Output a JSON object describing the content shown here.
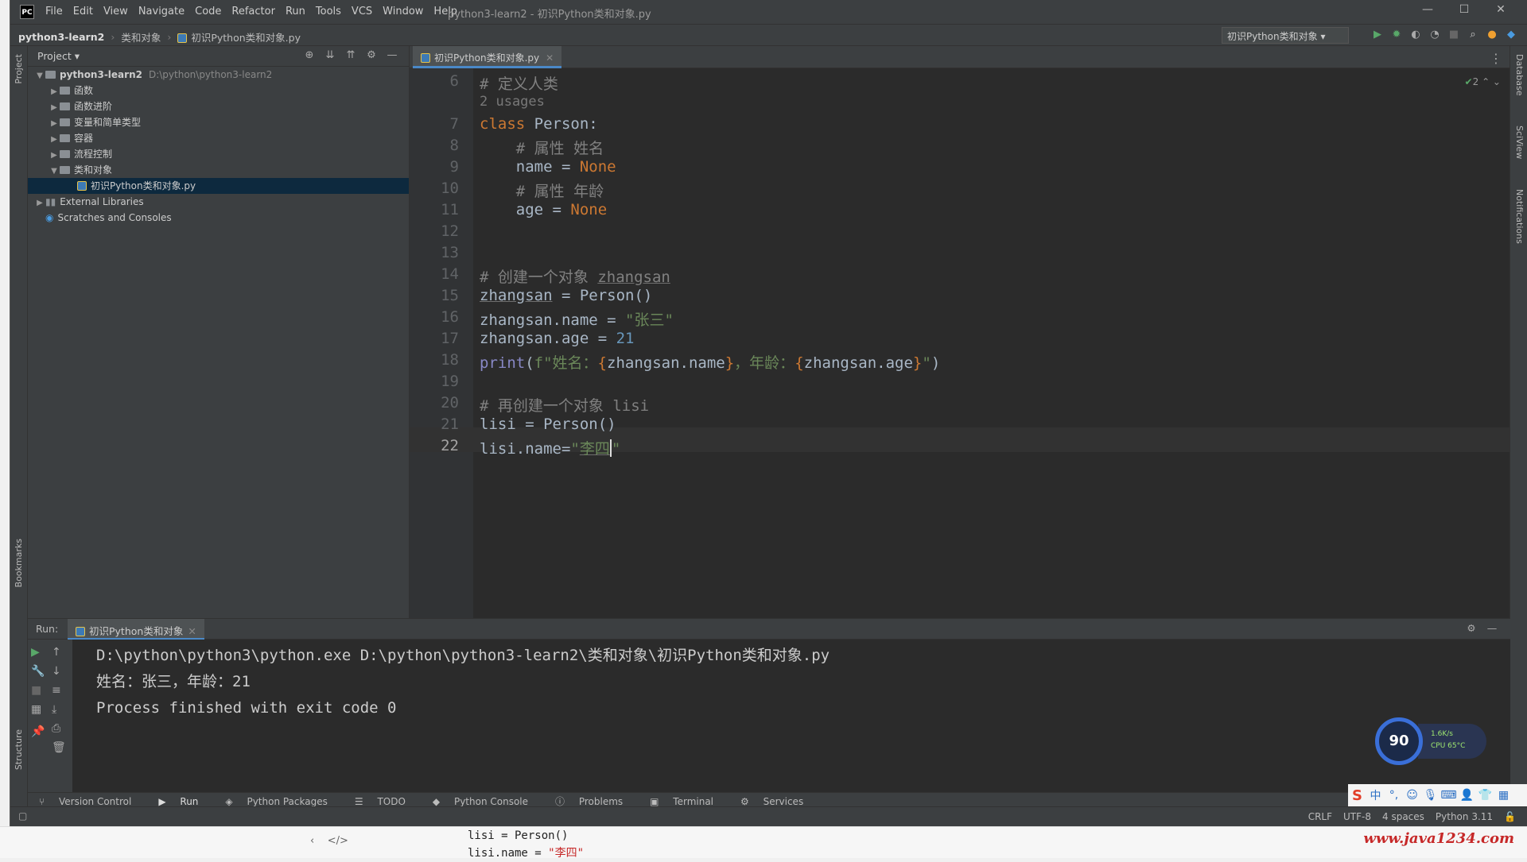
{
  "titlebar": {
    "logo": "PC",
    "menu": [
      "File",
      "Edit",
      "View",
      "Navigate",
      "Code",
      "Refactor",
      "Run",
      "Tools",
      "VCS",
      "Window",
      "Help"
    ],
    "title": "python3-learn2 - 初识Python类和对象.py",
    "controls": [
      "—",
      "☐",
      "✕"
    ]
  },
  "navbar": {
    "breadcrumb": [
      "python3-learn2",
      "类和对象",
      "初识Python类和对象.py"
    ],
    "run_config": "初识Python类和对象"
  },
  "left_strip": {
    "project": "Project",
    "bookmarks": "Bookmarks",
    "structure": "Structure"
  },
  "right_strip": {
    "database": "Database",
    "sciview": "SciView",
    "notifications": "Notifications"
  },
  "project": {
    "header": "Project",
    "tree": [
      {
        "label": "python3-learn2",
        "path": "D:\\python\\python3-learn2"
      },
      {
        "label": "函数"
      },
      {
        "label": "函数进阶"
      },
      {
        "label": "变量和简单类型"
      },
      {
        "label": "容器"
      },
      {
        "label": "流程控制"
      },
      {
        "label": "类和对象"
      },
      {
        "label": "初识Python类和对象.py"
      },
      {
        "label": "External Libraries"
      },
      {
        "label": "Scratches and Consoles"
      }
    ]
  },
  "editor": {
    "tab": "初识Python类和对象.py",
    "inspection_count": "2",
    "usages": "2 usages",
    "line_numbers": [
      "6",
      "7",
      "8",
      "9",
      "10",
      "11",
      "12",
      "13",
      "14",
      "15",
      "16",
      "17",
      "18",
      "19",
      "20",
      "21",
      "22"
    ]
  },
  "run": {
    "label": "Run:",
    "tab": "初识Python类和对象",
    "output": [
      "D:\\python\\python3\\python.exe D:\\python\\python3-learn2\\类和对象\\初识Python类和对象.py",
      "姓名：张三，年龄：21",
      "",
      "Process finished with exit code 0"
    ]
  },
  "gauge": {
    "score": "90",
    "net": "1.6K/s",
    "cpu": "CPU 65°C"
  },
  "toolbar": [
    "Version Control",
    "Run",
    "Python Packages",
    "TODO",
    "Python Console",
    "Problems",
    "Terminal",
    "Services"
  ],
  "status": [
    "CRLF",
    "UTF-8",
    "4 spaces",
    "Python 3.11"
  ],
  "ime": [
    "中"
  ],
  "below": {
    "line1": "lisi = Person()",
    "line2_pre": "lisi.name = ",
    "line2_str": "\"李四\"",
    "watermark": "www.java1234.com"
  }
}
